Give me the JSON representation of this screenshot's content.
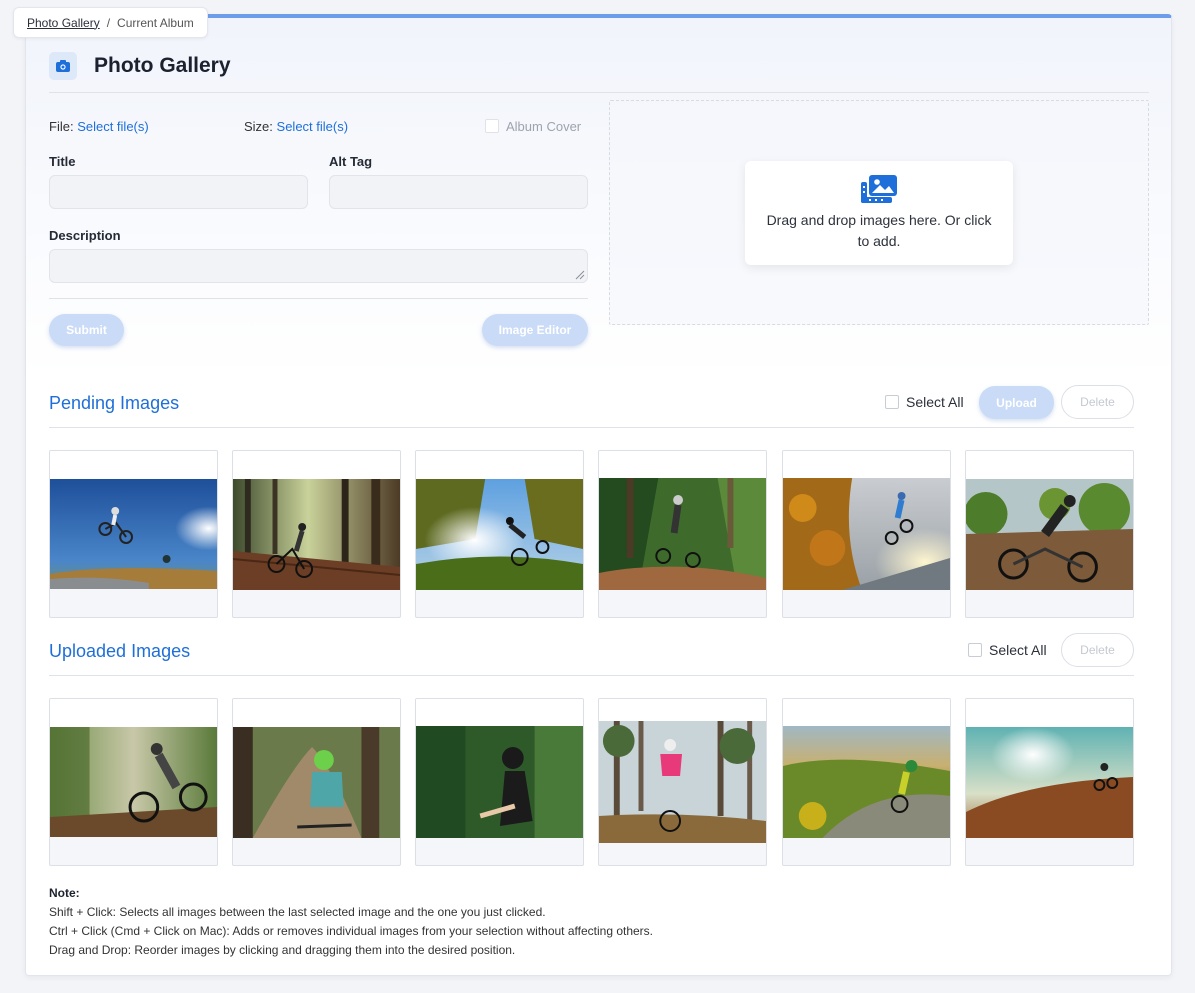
{
  "breadcrumb": {
    "home": "Photo Gallery",
    "separator": "/",
    "current": "Current Album"
  },
  "header": {
    "icon": "camera-icon",
    "title": "Photo Gallery"
  },
  "form": {
    "file_label": "File:",
    "file_link": "Select file(s)",
    "size_label": "Size:",
    "size_link": "Select file(s)",
    "album_cover_label": "Album Cover",
    "title_label": "Title",
    "title_value": "",
    "alt_label": "Alt Tag",
    "alt_value": "",
    "description_label": "Description",
    "description_value": "",
    "submit_label": "Submit",
    "image_editor_label": "Image Editor"
  },
  "dropzone": {
    "icon": "images-icon",
    "text": "Drag and drop images here. Or click to add."
  },
  "pending": {
    "title": "Pending Images",
    "select_all": "Select All",
    "upload_label": "Upload",
    "delete_label": "Delete",
    "images": [
      {
        "alt": "Biker jumping against blue sky"
      },
      {
        "alt": "Biker on wooden ramp in forest"
      },
      {
        "alt": "Biker jumping in sunlit woods"
      },
      {
        "alt": "Biker on forest trail"
      },
      {
        "alt": "Biker in blue on rocky slope"
      },
      {
        "alt": "Biker riding on dirt path"
      }
    ]
  },
  "uploaded": {
    "title": "Uploaded Images",
    "select_all": "Select All",
    "delete_label": "Delete",
    "images": [
      {
        "alt": "Biker speeding through forest"
      },
      {
        "alt": "Rider with green helmet on trail"
      },
      {
        "alt": "Rider in green forest"
      },
      {
        "alt": "Rider in pink jersey among pines"
      },
      {
        "alt": "Rider in yellow on hillside"
      },
      {
        "alt": "Rider silhouetted against sun"
      }
    ]
  },
  "note": {
    "title": "Note:",
    "lines": [
      "Shift + Click: Selects all images between the last selected image and the one you just clicked.",
      "Ctrl + Click (Cmd + Click on Mac): Adds or removes individual images from your selection without affecting others.",
      "Drag and Drop: Reorder images by clicking and dragging them into the desired position."
    ]
  },
  "colors": {
    "accent": "#1e6fd9",
    "top_border": "#6d9cea",
    "button_disabled": "#c9dbf7"
  }
}
